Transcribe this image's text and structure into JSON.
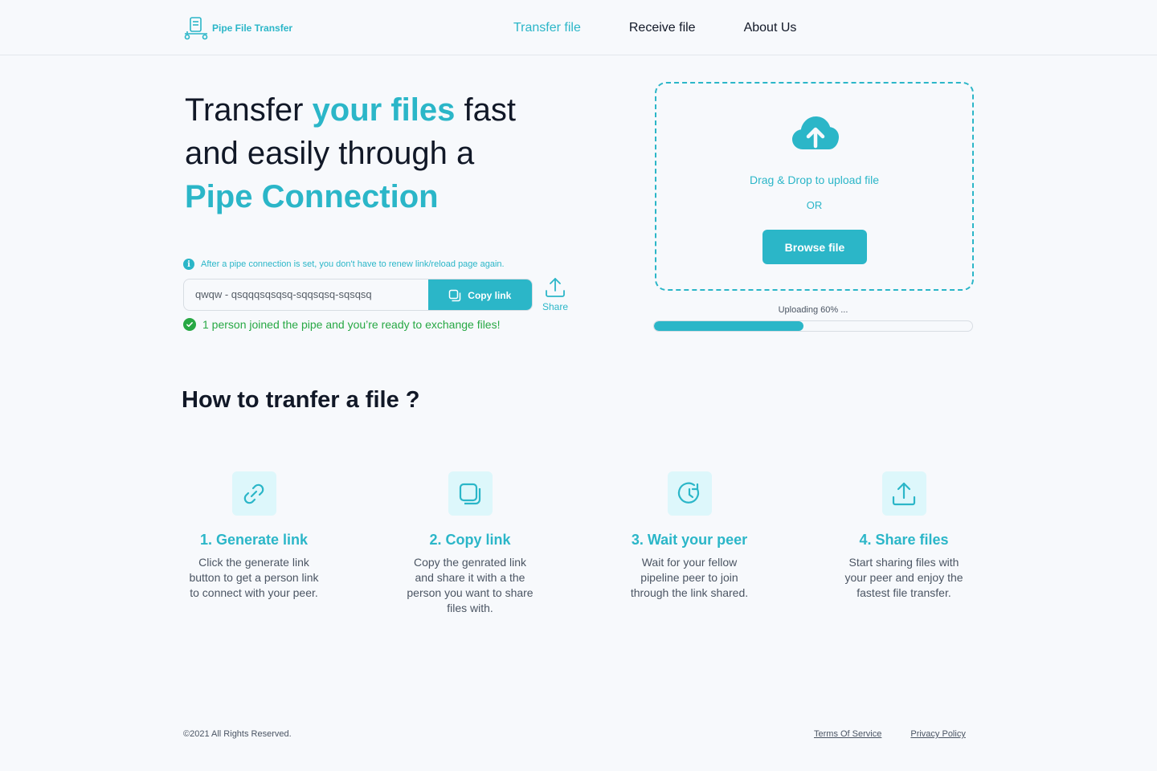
{
  "brand": {
    "name": "Pipe File Transfer"
  },
  "nav": {
    "items": [
      {
        "label": "Transfer file",
        "active": true
      },
      {
        "label": "Receive file",
        "active": false
      },
      {
        "label": "About Us",
        "active": false
      }
    ]
  },
  "hero": {
    "line1_a": "Transfer ",
    "line1_b": "your files",
    "line1_c": " fast",
    "line2": "and easily through a",
    "line3": "Pipe Connection"
  },
  "pipe": {
    "info": "After a pipe connection is set, you don't have to renew link/reload page again.",
    "link_value": "qwqw - qsqqqsqsqsq-sqqsqsq-sqsqsq",
    "copy_label": "Copy link",
    "share_label": "Share",
    "success": "1 person joined the pipe and you’re ready to exchange files!"
  },
  "upload": {
    "drag_text": "Drag  & Drop to upload file",
    "or_text": "OR",
    "browse_label": "Browse file",
    "status": "Uploading 60% ...",
    "progress": 0.47
  },
  "howto": {
    "title": "How to tranfer a file ?",
    "steps": [
      {
        "icon": "link-icon",
        "title": "1.  Generate link",
        "desc": "Click the generate link button to get a person link to connect with your peer."
      },
      {
        "icon": "copy-icon",
        "title": "2.  Copy link",
        "desc": "Copy the genrated link and share it with a the person you want to share files with."
      },
      {
        "icon": "clock-icon",
        "title": "3.  Wait your peer",
        "desc": "Wait for your fellow pipeline peer to join through the link shared."
      },
      {
        "icon": "upload-icon",
        "title": "4.  Share files",
        "desc": "Start sharing files with your peer and enjoy the fastest file transfer."
      }
    ]
  },
  "footer": {
    "copyright": "©2021 All Rights Reserved.",
    "terms": "Terms Of Service",
    "privacy": "Privacy Policy"
  },
  "colors": {
    "accent": "#2bb6c8",
    "success": "#27a844",
    "text": "#111827"
  }
}
